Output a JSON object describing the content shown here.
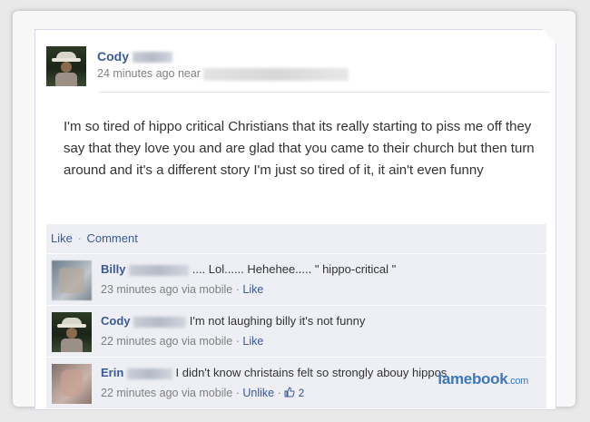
{
  "post": {
    "author": "Cody",
    "time": "24 minutes ago near",
    "text": "I'm so tired of hippo critical Christians that its really starting to piss me off they say that they love you and are glad that you came to their church but then turn around and it's a different story I'm just so tired of it, it ain't even funny"
  },
  "actions": {
    "like": "Like",
    "separator": "·",
    "comment": "Comment"
  },
  "comments": [
    {
      "name": "Billy",
      "text": ".... Lol...... Hehehee..... \" hippo-critical \"",
      "time": "23 minutes ago via mobile",
      "separator": "·",
      "action": "Like"
    },
    {
      "name": "Cody",
      "text": "I'm not laughing billy it's not funny",
      "time": "22 minutes ago via mobile",
      "separator": "·",
      "action": "Like"
    },
    {
      "name": "Erin",
      "text": "I didn't know christains felt so strongly abouy hippos",
      "time": "22 minutes ago via mobile",
      "separator": "·",
      "action": "Unlike",
      "separator2": "·",
      "likes": "2"
    }
  ],
  "watermark": {
    "main": "lamebook",
    "suffix": ".com"
  },
  "colors": {
    "link": "#3b5998",
    "panel": "#edeff4",
    "watermark": "#3b78c1"
  },
  "icons": {
    "like": "thumbs-up-icon"
  }
}
